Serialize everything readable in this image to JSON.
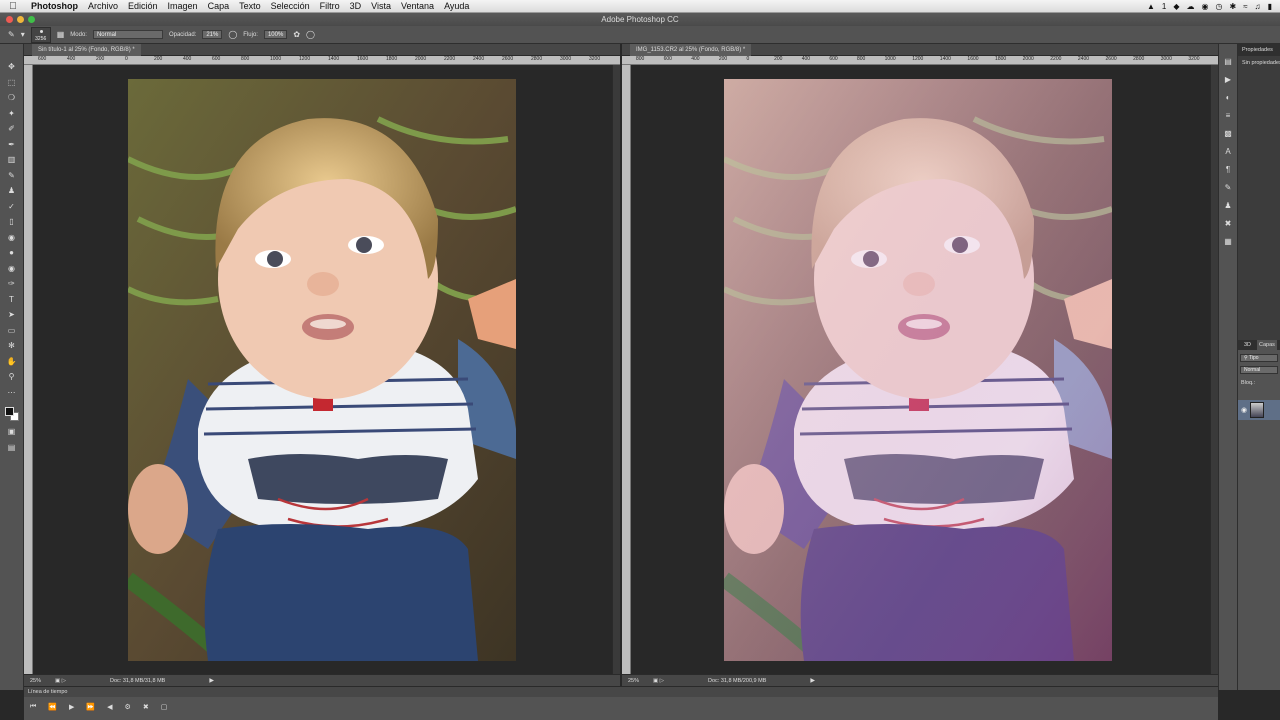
{
  "menubar": {
    "apple": "",
    "items": [
      {
        "label": "Photoshop"
      },
      {
        "label": "Archivo"
      },
      {
        "label": "Edición"
      },
      {
        "label": "Imagen"
      },
      {
        "label": "Capa"
      },
      {
        "label": "Texto"
      },
      {
        "label": "Selección"
      },
      {
        "label": "Filtro"
      },
      {
        "label": "3D"
      },
      {
        "label": "Vista"
      },
      {
        "label": "Ventana"
      },
      {
        "label": "Ayuda"
      }
    ],
    "tray_badge": "1"
  },
  "window": {
    "title": "Adobe Photoshop CC"
  },
  "options": {
    "brush_size": "3256",
    "mode_label": "Modo:",
    "mode_value": "Normal",
    "opacity_label": "Opacidad:",
    "opacity_value": "21%",
    "flow_label": "Flujo:",
    "flow_value": "100%"
  },
  "doc_left": {
    "tab": "Sin título-1 al 25% (Fondo, RGB/8) *",
    "ruler": [
      "600",
      "400",
      "200",
      "0",
      "200",
      "400",
      "600",
      "800",
      "1000",
      "1200",
      "1400",
      "1600",
      "1800",
      "2000",
      "2200",
      "2400",
      "2600",
      "2800",
      "3000",
      "3200"
    ],
    "zoom": "25%",
    "doc_info": "Doc: 31,8 MB/31,8 MB"
  },
  "doc_right": {
    "tab": "IMG_1153.CR2 al 25% (Fondo, RGB/8) *",
    "ruler": [
      "800",
      "600",
      "400",
      "200",
      "0",
      "200",
      "400",
      "600",
      "800",
      "1000",
      "1200",
      "1400",
      "1600",
      "1800",
      "2000",
      "2200",
      "2400",
      "2600",
      "2800",
      "3000",
      "3200"
    ],
    "zoom": "25%",
    "doc_info": "Doc: 31,8 MB/200,9 MB"
  },
  "panels": {
    "properties_tab": "Propiedades",
    "properties_body": "Sin propiedades",
    "layers_tabs": [
      "3D",
      "Capas"
    ],
    "kind_filter": "Tipo",
    "blend_mode": "Normal",
    "lock_label": "Bloq.:"
  },
  "timeline": {
    "title": "Línea de tiempo"
  }
}
